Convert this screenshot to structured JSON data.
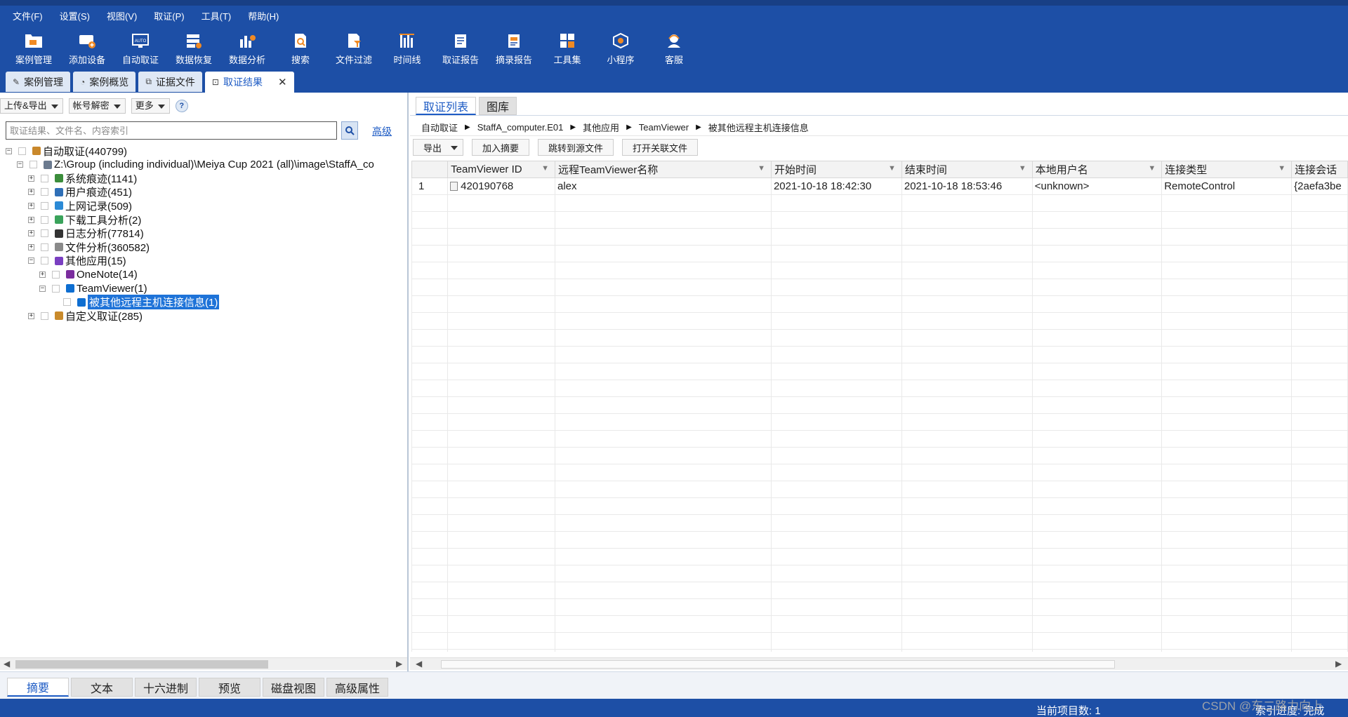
{
  "menu": [
    "文件(F)",
    "设置(S)",
    "视图(V)",
    "取证(P)",
    "工具(T)",
    "帮助(H)"
  ],
  "toolbar": [
    {
      "label": "案例管理",
      "icon": "case-folder-icon"
    },
    {
      "label": "添加设备",
      "icon": "add-device-icon"
    },
    {
      "label": "自动取证",
      "icon": "auto-forensics-icon"
    },
    {
      "label": "数据恢复",
      "icon": "data-recovery-icon"
    },
    {
      "label": "数据分析",
      "icon": "data-analysis-icon"
    },
    {
      "label": "搜索",
      "icon": "search-doc-icon"
    },
    {
      "label": "文件过滤",
      "icon": "file-filter-icon"
    },
    {
      "label": "时间线",
      "icon": "timeline-icon"
    },
    {
      "label": "取证报告",
      "icon": "report-icon"
    },
    {
      "label": "摘录报告",
      "icon": "excerpt-report-icon"
    },
    {
      "label": "工具集",
      "icon": "toolset-icon"
    },
    {
      "label": "小程序",
      "icon": "mini-program-icon"
    },
    {
      "label": "客服",
      "icon": "customer-service-icon"
    }
  ],
  "doc_tabs": [
    {
      "label": "案例管理",
      "active": false
    },
    {
      "label": "案例概览",
      "active": false
    },
    {
      "label": "证据文件",
      "active": false
    },
    {
      "label": "取证结果",
      "active": true
    }
  ],
  "left": {
    "buttons": [
      "上传&导出",
      "帐号解密",
      "更多"
    ],
    "help": "?",
    "search_placeholder": "取证结果、文件名、内容索引",
    "advanced": "高级"
  },
  "tree": [
    {
      "label": "自动取证(440799)",
      "level": 0,
      "expander": "-",
      "icon": "forensics-root-icon"
    },
    {
      "label": "Z:\\Group (including individual)\\Meiya Cup 2021 (all)\\image\\StaffA_co",
      "level": 1,
      "expander": "-",
      "icon": "image-file-icon"
    },
    {
      "label": "系统痕迹(1141)",
      "level": 2,
      "expander": "+",
      "icon": "system-trace-icon"
    },
    {
      "label": "用户痕迹(451)",
      "level": 2,
      "expander": "+",
      "icon": "user-trace-icon"
    },
    {
      "label": "上网记录(509)",
      "level": 2,
      "expander": "+",
      "icon": "globe-icon"
    },
    {
      "label": "下载工具分析(2)",
      "level": 2,
      "expander": "+",
      "icon": "download-tool-icon"
    },
    {
      "label": "日志分析(77814)",
      "level": 2,
      "expander": "+",
      "icon": "log-icon"
    },
    {
      "label": "文件分析(360582)",
      "level": 2,
      "expander": "+",
      "icon": "file-analysis-icon"
    },
    {
      "label": "其他应用(15)",
      "level": 2,
      "expander": "-",
      "icon": "apps-icon"
    },
    {
      "label": "OneNote(14)",
      "level": 3,
      "expander": "+",
      "icon": "onenote-icon"
    },
    {
      "label": "TeamViewer(1)",
      "level": 3,
      "expander": "-",
      "icon": "teamviewer-icon"
    },
    {
      "label": "被其他远程主机连接信息(1)",
      "level": 4,
      "expander": "",
      "icon": "teamviewer-icon",
      "selected": true
    },
    {
      "label": "自定义取证(285)",
      "level": 2,
      "expander": "+",
      "icon": "custom-forensics-icon"
    }
  ],
  "right": {
    "tabs": [
      {
        "label": "取证列表",
        "active": true
      },
      {
        "label": "图库",
        "active": false
      }
    ],
    "breadcrumb": [
      "自动取证",
      "StaffA_computer.E01",
      "其他应用",
      "TeamViewer",
      "被其他远程主机连接信息"
    ],
    "actions": [
      "导出",
      "加入摘要",
      "跳转到源文件",
      "打开关联文件"
    ],
    "columns": [
      "TeamViewer ID",
      "远程TeamViewer名称",
      "开始时间",
      "结束时间",
      "本地用户名",
      "连接类型",
      "连接会话"
    ],
    "rows": [
      [
        "1",
        "420190768",
        "alex",
        "2021-10-18 18:42:30",
        "2021-10-18 18:53:46",
        "<unknown>",
        "RemoteControl",
        "{2aefa3be"
      ]
    ]
  },
  "bottom_tabs": [
    {
      "label": "摘要",
      "active": true
    },
    {
      "label": "文本",
      "active": false
    },
    {
      "label": "十六进制",
      "active": false
    },
    {
      "label": "预览",
      "active": false
    },
    {
      "label": "磁盘视图",
      "active": false
    },
    {
      "label": "高级属性",
      "active": false
    }
  ],
  "status": {
    "count": "当前项目数: 1",
    "index": "索引进度: 完成"
  },
  "watermark": "CSDN @东二路力向上",
  "colors": {
    "header": "#1d4fa6",
    "accent": "#1d5bc4",
    "selection": "#1e73d8"
  }
}
